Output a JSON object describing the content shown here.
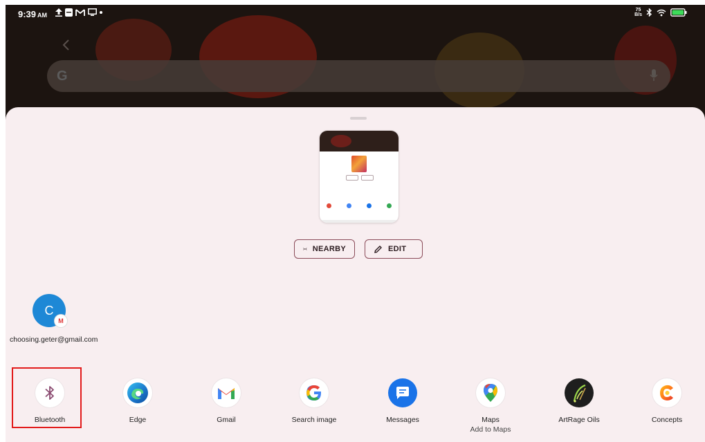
{
  "status_bar": {
    "time": "9:39",
    "ampm": "AM",
    "net_speed_value": "75",
    "net_speed_unit": "B/s"
  },
  "share_sheet": {
    "nearby_label": "NEARBY",
    "edit_label": "EDIT",
    "contact": {
      "initial": "C",
      "name": "choosing.geter@gmail.com"
    },
    "apps": [
      {
        "label": "Bluetooth",
        "sub": "",
        "icon": "bluetooth-icon"
      },
      {
        "label": "Edge",
        "sub": "",
        "icon": "edge-icon"
      },
      {
        "label": "Gmail",
        "sub": "",
        "icon": "gmail-icon"
      },
      {
        "label": "Search image",
        "sub": "",
        "icon": "google-icon"
      },
      {
        "label": "Messages",
        "sub": "",
        "icon": "messages-icon"
      },
      {
        "label": "Maps",
        "sub": "Add to Maps",
        "icon": "maps-icon"
      },
      {
        "label": "ArtRage Oils",
        "sub": "",
        "icon": "artrage-icon"
      },
      {
        "label": "Concepts",
        "sub": "",
        "icon": "concepts-icon"
      }
    ]
  },
  "colors": {
    "sheet_bg": "#f8eef0",
    "chip_border": "#8a4a58",
    "highlight": "#e21b1b"
  }
}
